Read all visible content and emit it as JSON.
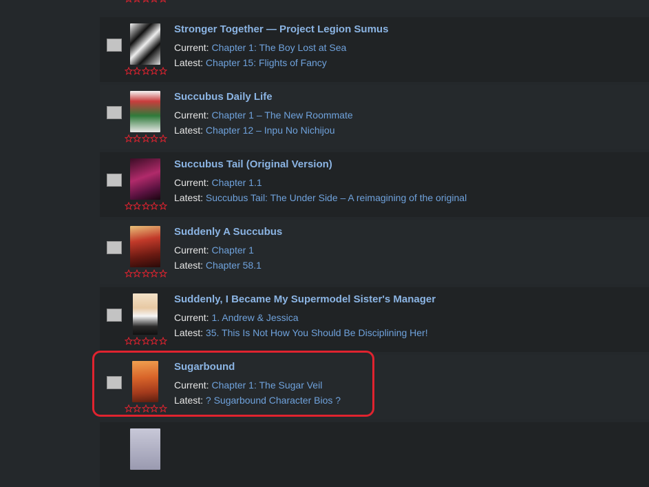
{
  "rows": [
    {
      "title": "Stronger Together — Project Legion Sumus",
      "current_label": "Current:",
      "current": "Chapter 1: The Boy Lost at Sea",
      "latest_label": "Latest:",
      "latest": "Chapter 15: Flights of Fancy",
      "rating": 0
    },
    {
      "title": "Succubus Daily Life",
      "current_label": "Current:",
      "current": "Chapter 1 – The New Roommate",
      "latest_label": "Latest:",
      "latest": "Chapter 12 – Inpu No Nichijou",
      "rating": 0
    },
    {
      "title": "Succubus Tail (Original Version)",
      "current_label": "Current:",
      "current": "Chapter 1.1",
      "latest_label": "Latest:",
      "latest": "Succubus Tail: The Under Side – A reimagining of the original",
      "rating": 0
    },
    {
      "title": "Suddenly A Succubus",
      "current_label": "Current:",
      "current": "Chapter 1",
      "latest_label": "Latest:",
      "latest": "Chapter 58.1",
      "rating": 0
    },
    {
      "title": "Suddenly, I Became My Supermodel Sister's Manager",
      "current_label": "Current:",
      "current": "1. Andrew & Jessica",
      "latest_label": "Latest:",
      "latest": "35. This Is Not How You Should Be Disciplining Her!",
      "rating": 0
    },
    {
      "title": "Sugarbound",
      "current_label": "Current:",
      "current": "Chapter 1: The Sugar Veil",
      "latest_label": "Latest:",
      "latest": "? Sugarbound Character Bios ?",
      "rating": 0
    }
  ],
  "colors": {
    "page_bg": "#24282b",
    "row_bg": "#202325",
    "title": "#8bb4e3",
    "link": "#6fa2dc",
    "star": "#e0232f",
    "highlight": "#e0232f"
  }
}
